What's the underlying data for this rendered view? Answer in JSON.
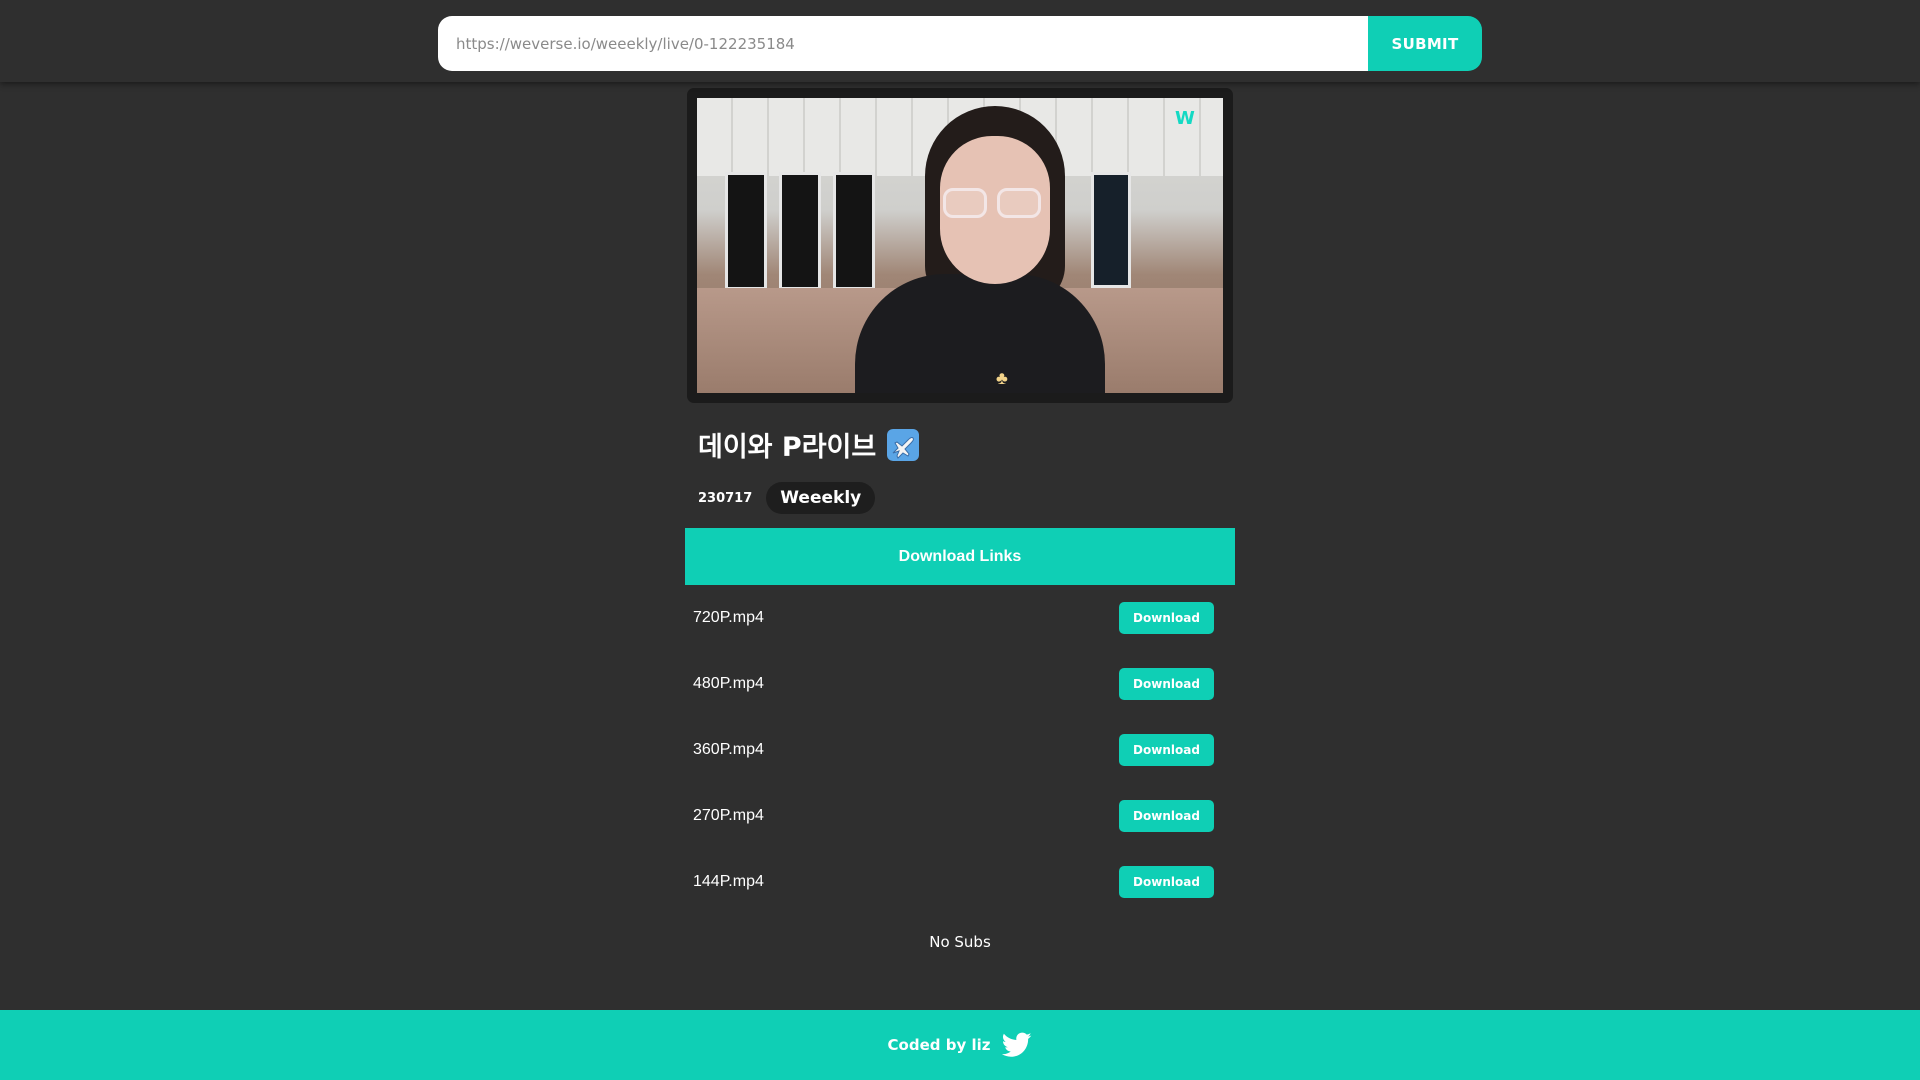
{
  "search": {
    "placeholder": "https://weverse.io/weeekly/live/0-122235184",
    "submit_label": "SUBMIT"
  },
  "video": {
    "title": "데이와 P라이브",
    "title_icon": "airplane-icon",
    "date": "230717",
    "artist": "Weeekly"
  },
  "downloads": {
    "header": "Download Links",
    "items": [
      {
        "name": "720P.mp4",
        "button": "Download"
      },
      {
        "name": "480P.mp4",
        "button": "Download"
      },
      {
        "name": "360P.mp4",
        "button": "Download"
      },
      {
        "name": "270P.mp4",
        "button": "Download"
      },
      {
        "name": "144P.mp4",
        "button": "Download"
      }
    ]
  },
  "subs": {
    "text": "No Subs"
  },
  "footer": {
    "text": "Coded by liz",
    "icon": "twitter-icon"
  },
  "colors": {
    "accent": "#0fcfb5",
    "background": "#2f2f2f",
    "badge_bg": "#1e1e1e"
  }
}
